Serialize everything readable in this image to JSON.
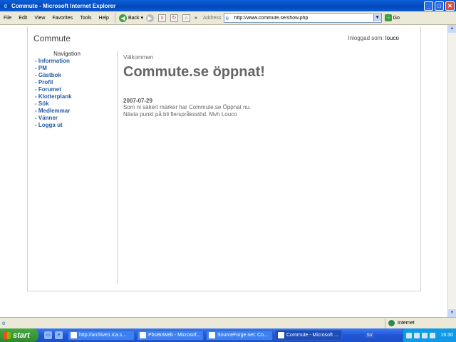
{
  "window": {
    "title": "Commute - Microsoft Internet Explorer"
  },
  "menu": [
    "File",
    "Edit",
    "View",
    "Favorites",
    "Tools",
    "Help"
  ],
  "toolbar": {
    "back_label": "Back",
    "more_label": "»",
    "address_label": "Address",
    "url": "http://www.commute.se/show.php",
    "go_label": "Go"
  },
  "site": {
    "title": "Commute",
    "login_label": "Inloggad som:",
    "login_user": "louco"
  },
  "nav": {
    "heading": "Navigation",
    "items": [
      "- Information",
      "- PM",
      "- Gästbok",
      "- Profil",
      "- Forumet",
      "- Klotterplank",
      "- Sök",
      "- Medlemmar",
      "- Vänner",
      "- Logga ut"
    ]
  },
  "content": {
    "welcome": "Välkommen",
    "headline": "Commute.se öppnat!",
    "news_date": "2007-07-29",
    "news_lines": [
      "Som ni säkert märker har Commute.se Öppnat nu.",
      "Nästa punkt på bli flerspråksstöd. Mvh Louco"
    ]
  },
  "statusbar": {
    "zone": "Internet"
  },
  "taskbar": {
    "start": "start",
    "tasks": [
      "http://archive1.ica.s...",
      "PbsBoWeb - Microsof...",
      "SourceForge.net: Co...",
      "Commute - Microsoft ..."
    ],
    "lang": "SV",
    "clock": "16:30"
  },
  "colors": {
    "link": "#245aaa",
    "titlebar": "#0a5fd8"
  }
}
